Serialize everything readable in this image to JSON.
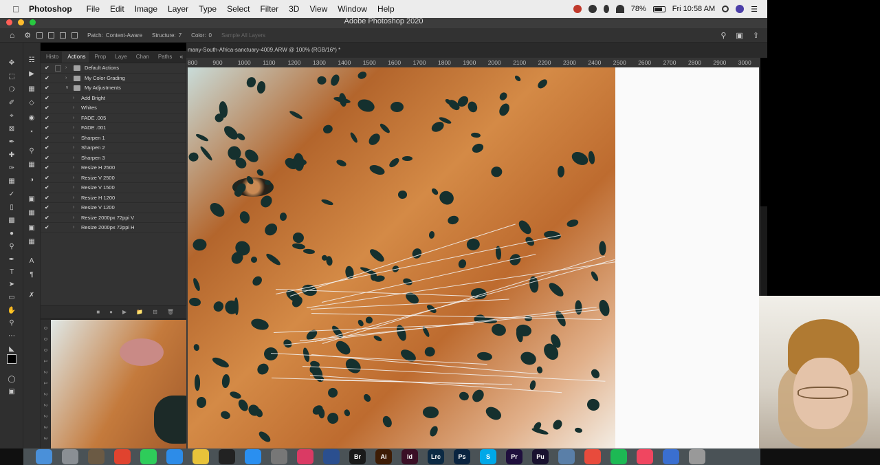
{
  "menubar": {
    "app": "Photoshop",
    "items": [
      "File",
      "Edit",
      "Image",
      "Layer",
      "Type",
      "Select",
      "Filter",
      "3D",
      "View",
      "Window",
      "Help"
    ],
    "battery": "78%",
    "clock": "Fri 10:58 AM"
  },
  "window": {
    "title": "Adobe Photoshop 2020"
  },
  "options": {
    "patch_label": "Patch:",
    "patch_value": "Content-Aware",
    "structure_label": "Structure:",
    "structure_value": "7",
    "color_label": "Color:",
    "color_value": "0",
    "sample_all": "Sample All Layers"
  },
  "panel": {
    "tabs": [
      "Histo",
      "Actions",
      "Prop",
      "Laye",
      "Chan",
      "Paths"
    ],
    "actions": [
      {
        "label": "Default Actions",
        "type": "set"
      },
      {
        "label": "My Color Grading",
        "type": "set"
      },
      {
        "label": "My Adjustments",
        "type": "set"
      },
      {
        "label": "Add Bright",
        "type": "action"
      },
      {
        "label": "Whites",
        "type": "action"
      },
      {
        "label": "FADE .005",
        "type": "action"
      },
      {
        "label": "FADE .001",
        "type": "action"
      },
      {
        "label": "Sharpen 1",
        "type": "action"
      },
      {
        "label": "Sharpen 2",
        "type": "action"
      },
      {
        "label": "Sharpen 3",
        "type": "action"
      },
      {
        "label": "Resize H 2500",
        "type": "action"
      },
      {
        "label": "Resize V 2500",
        "type": "action"
      },
      {
        "label": "Resize V 1500",
        "type": "action"
      },
      {
        "label": "Resize H 1200",
        "type": "action"
      },
      {
        "label": "Resize V 1200",
        "type": "action"
      },
      {
        "label": "Resize 2000px 72ppi V",
        "type": "action"
      },
      {
        "label": "Resize 2000px 72ppi H",
        "type": "action"
      }
    ]
  },
  "document": {
    "tab_title": "many-South-Africa-sanctuary-4009.ARW @ 100% (RGB/16*) *",
    "ruler_ticks": [
      "800",
      "900",
      "1000",
      "1100",
      "1200",
      "1300",
      "1400",
      "1500",
      "1600",
      "1700",
      "1800",
      "1900",
      "2000",
      "2100",
      "2200",
      "2300",
      "2400",
      "2500",
      "2600",
      "2700",
      "2800",
      "2900",
      "3000"
    ]
  },
  "doc2": {
    "ruler_ticks": [
      "0",
      "0",
      "0",
      "1",
      "2",
      "1",
      "2",
      "2",
      "2",
      "3",
      "3"
    ]
  },
  "dock": {
    "apps": [
      "Finder",
      "Launchpad",
      "Preview",
      "Chrome",
      "Messages",
      "Safari",
      "Notes",
      "TV",
      "App Store",
      "Settings",
      "Creative Cloud",
      "Lightroom",
      "Br",
      "Ai",
      "Id",
      "Lrc",
      "Ps",
      "Skype",
      "Pr",
      "Pu",
      "Photos",
      "Calendar",
      "Spotify",
      "Music",
      "Downloads",
      "Trash"
    ]
  }
}
